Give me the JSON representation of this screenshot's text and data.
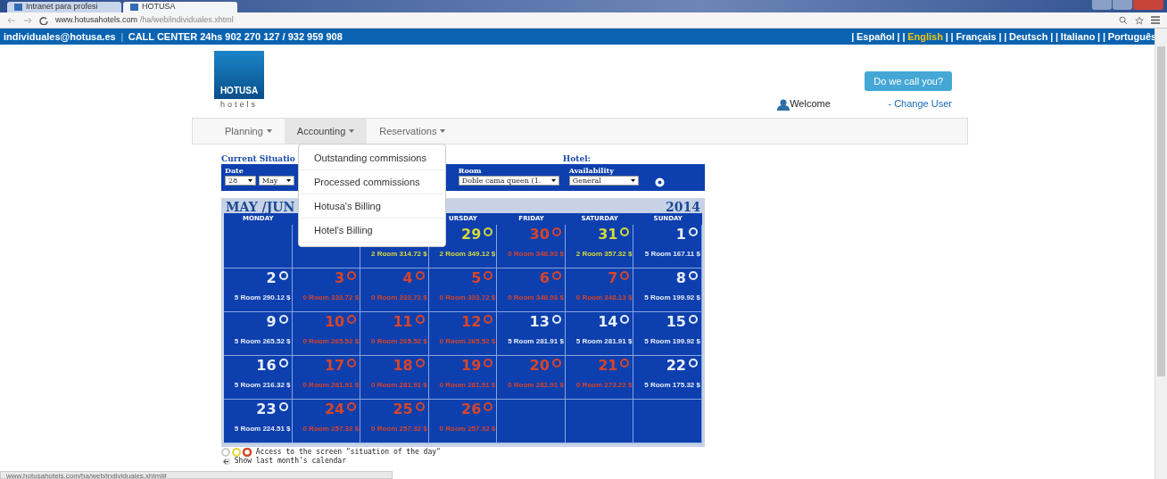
{
  "browser": {
    "tabs": [
      {
        "label": "Intranet para profesi",
        "selected": false
      },
      {
        "label": "HOTUSA",
        "selected": true
      }
    ],
    "url_host": "www.hotusahotels.com",
    "url_path": "/ha/web/individuales.xhtml",
    "status_url": "www.hotusahotels.com/ha/web/individuales.xhtml#"
  },
  "top_bar": {
    "email": "individuales@hotusa.es",
    "separator": "|",
    "call_center": "CALL CENTER **24hs** 902 270 127 / 932 959 908",
    "languages": [
      {
        "label": "Español",
        "selected": false
      },
      {
        "label": "English",
        "selected": true
      },
      {
        "label": "Français",
        "selected": false
      },
      {
        "label": "Deutsch",
        "selected": false
      },
      {
        "label": "Italiano",
        "selected": false
      },
      {
        "label": "Português",
        "selected": false
      }
    ]
  },
  "header": {
    "logo_name": "HOTUSA",
    "logo_sub": "hotels",
    "call_button": "Do we call you?",
    "welcome": "Welcome",
    "change_user": "- Change User"
  },
  "menu": [
    {
      "label": "Planning",
      "expanded": false
    },
    {
      "label": "Accounting",
      "expanded": true
    },
    {
      "label": "Reservations",
      "expanded": false
    }
  ],
  "dropdown": [
    "Outstanding commissions",
    "Processed commissions",
    "Hotusa's Billing",
    "Hotel's Billing"
  ],
  "filters": {
    "current": "Current Situatio",
    "hotel": "Hotel:",
    "date_label": "Date",
    "day": "28",
    "month": "May",
    "room_label": "Room",
    "room": "Doble cama queen (1.",
    "availability_label": "Availability",
    "availability": "General"
  },
  "calendar": {
    "title": "MAY /JUN",
    "year": "2014",
    "days": [
      {
        "kind": "label",
        "label": "MONDAY"
      },
      {
        "kind": "blank"
      },
      {
        "kind": "blank"
      },
      {
        "kind": "label",
        "label": "URSDAY"
      },
      {
        "kind": "label",
        "label": "FRIDAY"
      },
      {
        "kind": "label",
        "label": "SATURDAY"
      },
      {
        "kind": "label",
        "label": "SUNDAY"
      }
    ],
    "weeks": [
      [
        {
          "kind": "empty"
        },
        {
          "kind": "empty"
        },
        {
          "kind": "day",
          "room": "2 Room 314.72 $",
          "color": "#d6d83a"
        },
        {
          "day": "29",
          "room": "2 Room 349.12 $",
          "color": "#d6d83a"
        },
        {
          "day": "30",
          "room": "0 Room 348.93 $",
          "color": "#d6452a"
        },
        {
          "day": "31",
          "room": "2 Room 357.32 $",
          "color": "#d6d83a"
        },
        {
          "day": "1",
          "room": "5 Room 167.11 $",
          "color": "#e8eef8"
        }
      ],
      [
        {
          "day": "2",
          "room": "5 Room 290.12 $",
          "color": "#e8eef8"
        },
        {
          "day": "3",
          "room": "0 Room 333.72 $",
          "color": "#d6452a"
        },
        {
          "day": "4",
          "room": "0 Room 333.72 $",
          "color": "#d6452a"
        },
        {
          "day": "5",
          "room": "0 Room 333.72 $",
          "color": "#d6452a"
        },
        {
          "day": "6",
          "room": "0 Room 348.93 $",
          "color": "#d6452a"
        },
        {
          "day": "7",
          "room": "0 Room 348.13 $",
          "color": "#d6452a"
        },
        {
          "day": "8",
          "room": "5 Room 199.92 $",
          "color": "#e8eef8"
        }
      ],
      [
        {
          "day": "9",
          "room": "5 Room 265.52 $",
          "color": "#e8eef8"
        },
        {
          "day": "10",
          "room": "0 Room 265.52 $",
          "color": "#d6452a"
        },
        {
          "day": "11",
          "room": "0 Room 265.52 $",
          "color": "#d6452a"
        },
        {
          "day": "12",
          "room": "0 Room 265.52 $",
          "color": "#d6452a"
        },
        {
          "day": "13",
          "room": "5 Room 281.91 $",
          "color": "#e8eef8"
        },
        {
          "day": "14",
          "room": "5 Room 281.91 $",
          "color": "#e8eef8"
        },
        {
          "day": "15",
          "room": "5 Room 199.92 $",
          "color": "#e8eef8"
        }
      ],
      [
        {
          "day": "16",
          "room": "5 Room 216.32 $",
          "color": "#e8eef8"
        },
        {
          "day": "17",
          "room": "0 Room 281.91 $",
          "color": "#d6452a"
        },
        {
          "day": "18",
          "room": "0 Room 281.91 $",
          "color": "#d6452a"
        },
        {
          "day": "19",
          "room": "0 Room 281.91 $",
          "color": "#d6452a"
        },
        {
          "day": "20",
          "room": "0 Room 281.91 $",
          "color": "#d6452a"
        },
        {
          "day": "21",
          "room": "0 Room 273.22 $",
          "color": "#d6452a"
        },
        {
          "day": "22",
          "room": "5 Room 175.32 $",
          "color": "#e8eef8"
        }
      ],
      [
        {
          "day": "23",
          "room": "5 Room 224.51 $",
          "color": "#e8eef8"
        },
        {
          "day": "24",
          "room": "0 Room 257.32 $",
          "color": "#d6452a"
        },
        {
          "day": "25",
          "room": "0 Room 257.32 $",
          "color": "#d6452a"
        },
        {
          "day": "26",
          "room": "0 Room 257.32 $",
          "color": "#d6452a"
        },
        {
          "kind": "empty"
        },
        {
          "kind": "empty"
        },
        {
          "kind": "empty"
        }
      ]
    ]
  },
  "legend": {
    "text": "Access to the screen \"situation of the day\"",
    "last_month": "Show last month's calendar"
  }
}
